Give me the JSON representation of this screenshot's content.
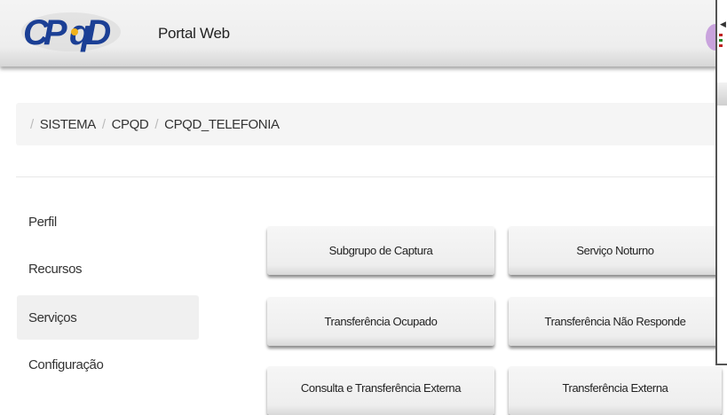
{
  "header": {
    "app_title": "Portal Web"
  },
  "breadcrumb": [
    "SISTEMA",
    "CPQD",
    "CPQD_TELEFONIA"
  ],
  "sidebar": {
    "items": [
      {
        "label": "Perfil"
      },
      {
        "label": "Recursos"
      },
      {
        "label": "Serviços",
        "active": true
      },
      {
        "label": "Configuração"
      }
    ]
  },
  "services": [
    {
      "label": "Subgrupo de Captura"
    },
    {
      "label": "Serviço Noturno"
    },
    {
      "label": "Transferência Ocupado"
    },
    {
      "label": "Transferência Não Responde"
    },
    {
      "label": "Consulta e Transferência Externa"
    },
    {
      "label": "Transferência Externa"
    }
  ],
  "colors": {
    "logo_blue": "#1b3f95",
    "logo_yellow": "#f2b21b",
    "active_item_bg": "#f0f0f0"
  }
}
